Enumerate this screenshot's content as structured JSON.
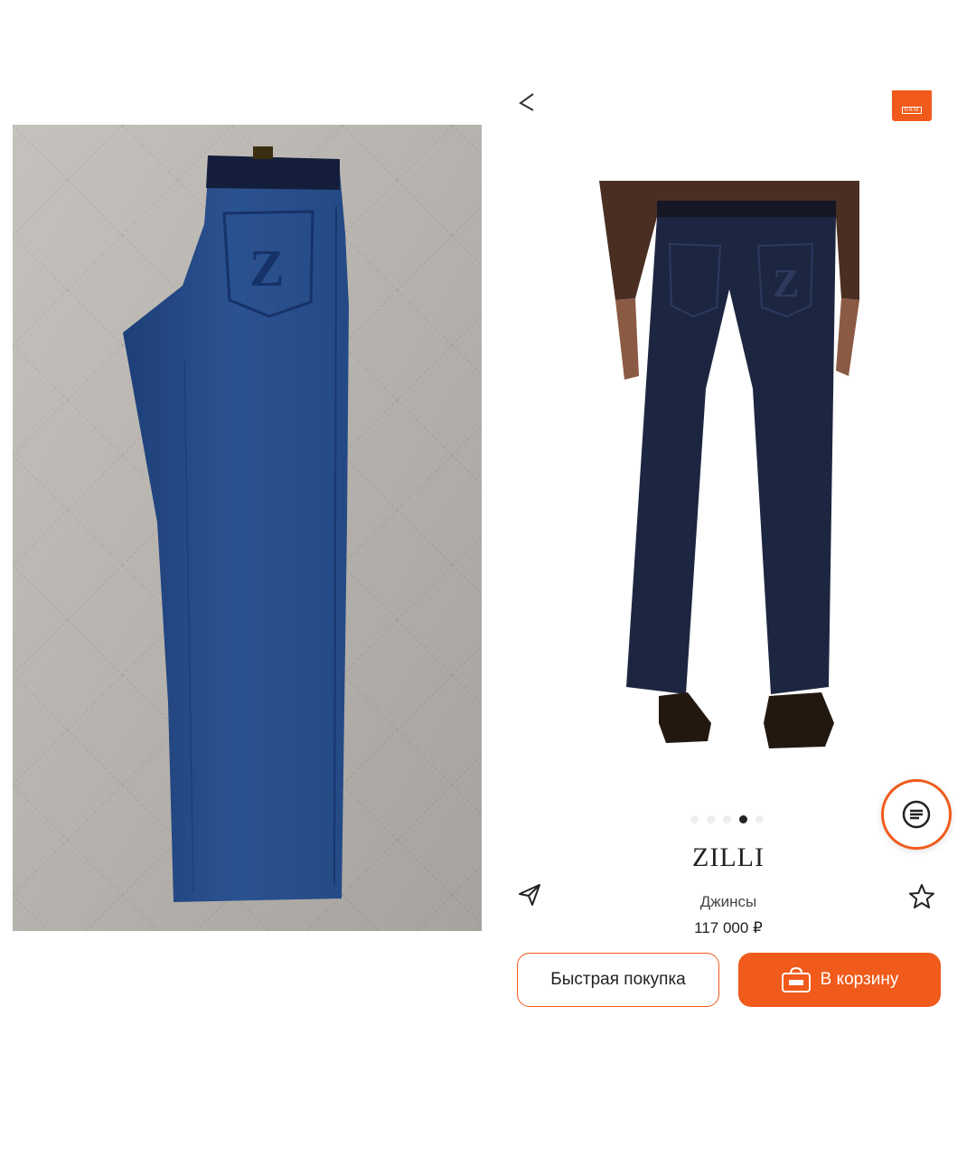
{
  "colors": {
    "accent": "#f05a1a",
    "text": "#222222",
    "dot_inactive": "#eeeeee",
    "dot_active": "#222222"
  },
  "left_photo": {
    "subject": "jeans-on-quilt"
  },
  "header": {
    "back_icon": "back-arrow-icon",
    "brand_badge_text": "НКМ"
  },
  "gallery": {
    "dot_count": 5,
    "active_index": 3
  },
  "product": {
    "brand": "ZILLI",
    "category": "Джинсы",
    "price": "117 000 ₽"
  },
  "actions": {
    "quick_buy_label": "Быстрая покупка",
    "add_to_cart_label": "В корзину",
    "share_icon": "send-icon",
    "favorite_icon": "star-icon",
    "chat_icon": "chat-icon",
    "cart_icon": "bag-icon"
  }
}
